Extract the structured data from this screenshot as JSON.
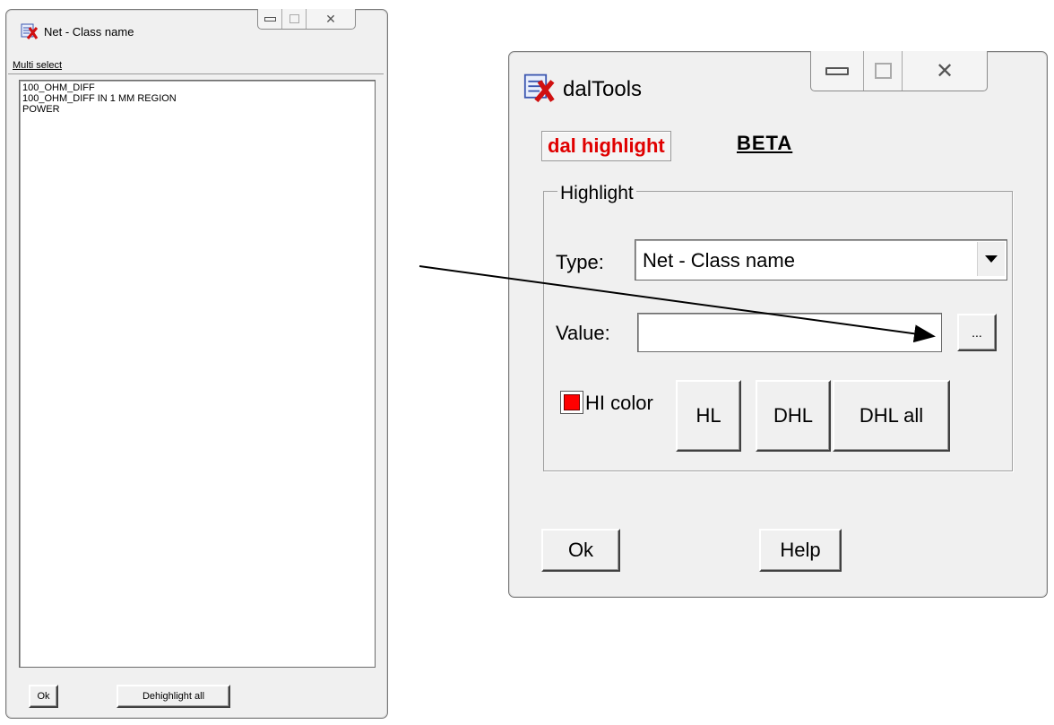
{
  "list_window": {
    "title": "Net - Class name",
    "multi_select_label": "Multi select",
    "items": [
      "100_OHM_DIFF",
      "100_OHM_DIFF IN 1 MM REGION",
      "POWER"
    ],
    "ok_label": "Ok",
    "dehighlight_all_label": "Dehighlight all"
  },
  "dal_window": {
    "title": "dalTools",
    "brand_label": "dal highlight",
    "beta_label": "BETA",
    "group_label": "Highlight",
    "type_label": "Type:",
    "type_value": "Net - Class name",
    "value_label": "Value:",
    "value_input": "",
    "browse_label": "...",
    "hi_color_label": "HI color",
    "hi_color": "#ff0000",
    "hl_label": "HL",
    "dhl_label": "DHL",
    "dhl_all_label": "DHL all",
    "ok_label": "Ok",
    "help_label": "Help"
  },
  "colors": {
    "brand_red": "#e00000",
    "window_bg": "#f0f0f0"
  }
}
